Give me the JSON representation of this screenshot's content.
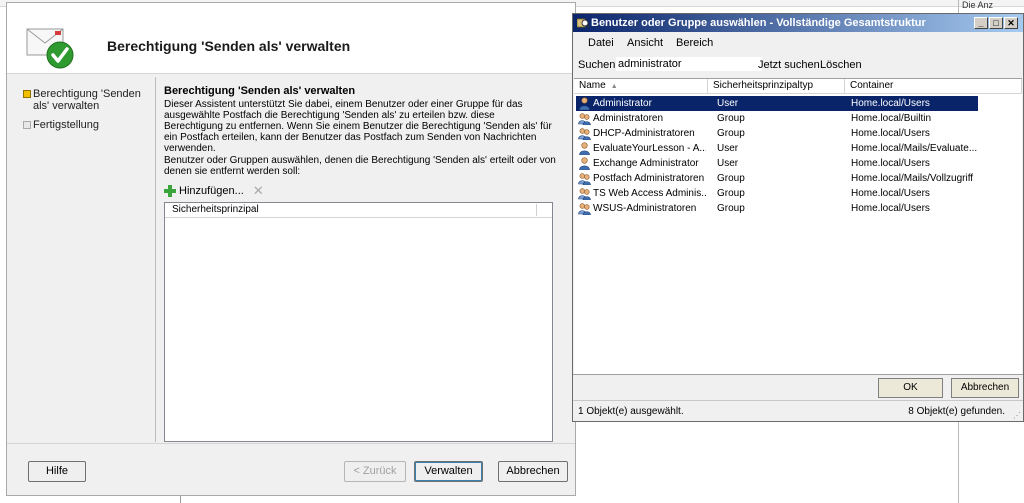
{
  "background": {
    "top_right_text": "Die Anz"
  },
  "wizard": {
    "title": "Berechtigung 'Senden als' verwalten",
    "steps": [
      {
        "label": "Berechtigung 'Senden als' verwalten",
        "state": "current"
      },
      {
        "label": "Fertigstellung",
        "state": "pending"
      }
    ],
    "content_title": "Berechtigung 'Senden als' verwalten",
    "description": "Dieser Assistent unterstützt Sie dabei, einem Benutzer oder einer Gruppe für das ausgewählte Postfach die Berechtigung 'Senden als' zu erteilen bzw. diese Berechtigung zu entfernen. Wenn Sie einem Benutzer die Berechtigung 'Senden als' für ein Postfach erteilen, kann der Benutzer das Postfach zum Senden von Nachrichten verwenden.",
    "instruction": "Benutzer oder Gruppen auswählen, denen die Berechtigung 'Senden als' erteilt oder von denen sie entfernt werden soll:",
    "add_label": "Hinzufügen...",
    "list_header": "Sicherheitsprinzipal",
    "buttons": {
      "help": "Hilfe",
      "back": "< Zurück",
      "manage": "Verwalten",
      "cancel": "Abbrechen"
    }
  },
  "dialog": {
    "title": "Benutzer oder Gruppe auswählen - Vollständige Gesamtstruktur",
    "menu": [
      "Datei",
      "Ansicht",
      "Bereich"
    ],
    "search_label": "Suchen:",
    "search_value": "administrator",
    "search_now": "Jetzt suchen",
    "clear": "Löschen",
    "columns": [
      "Name",
      "Sicherheitsprinzipaltyp",
      "Container"
    ],
    "rows": [
      {
        "name": "Administrator",
        "type": "User",
        "container": "Home.local/Users",
        "icon": "user-icon",
        "selected": true
      },
      {
        "name": "Administratoren",
        "type": "Group",
        "container": "Home.local/Builtin",
        "icon": "group-icon",
        "selected": false
      },
      {
        "name": "DHCP-Administratoren",
        "type": "Group",
        "container": "Home.local/Users",
        "icon": "group-icon",
        "selected": false
      },
      {
        "name": "EvaluateYourLesson - A...",
        "type": "User",
        "container": "Home.local/Mails/Evaluate...",
        "icon": "user-icon",
        "selected": false
      },
      {
        "name": "Exchange Administrator",
        "type": "User",
        "container": "Home.local/Users",
        "icon": "user-icon",
        "selected": false
      },
      {
        "name": "Postfach Administratoren",
        "type": "Group",
        "container": "Home.local/Mails/Vollzugriff",
        "icon": "group-icon",
        "selected": false
      },
      {
        "name": "TS Web Access Adminis...",
        "type": "Group",
        "container": "Home.local/Users",
        "icon": "group-icon",
        "selected": false
      },
      {
        "name": "WSUS-Administratoren",
        "type": "Group",
        "container": "Home.local/Users",
        "icon": "group-icon",
        "selected": false
      }
    ],
    "ok": "OK",
    "cancel": "Abbrechen",
    "status_left": "1 Objekt(e) ausgewählt.",
    "status_right": "8 Objekt(e) gefunden."
  },
  "colors": {
    "selection": "#0a246a",
    "title_gradient_start": "#0a246a",
    "title_gradient_end": "#a6caf0",
    "plus": "#3aa53a",
    "current_step": "#f2c000"
  }
}
